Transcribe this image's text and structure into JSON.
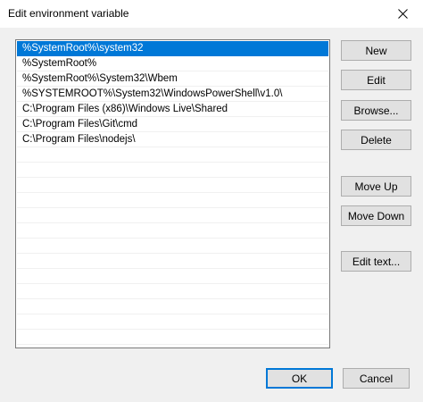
{
  "window": {
    "title": "Edit environment variable"
  },
  "list": {
    "items": [
      "%SystemRoot%\\system32",
      "%SystemRoot%",
      "%SystemRoot%\\System32\\Wbem",
      "%SYSTEMROOT%\\System32\\WindowsPowerShell\\v1.0\\",
      "C:\\Program Files (x86)\\Windows Live\\Shared",
      "C:\\Program Files\\Git\\cmd",
      "C:\\Program Files\\nodejs\\"
    ],
    "selected_index": 0
  },
  "buttons": {
    "new": "New",
    "edit": "Edit",
    "browse": "Browse...",
    "delete": "Delete",
    "move_up": "Move Up",
    "move_down": "Move Down",
    "edit_text": "Edit text...",
    "ok": "OK",
    "cancel": "Cancel"
  },
  "colors": {
    "selection": "#0078d7",
    "dialog_background": "#f0f0f0"
  }
}
